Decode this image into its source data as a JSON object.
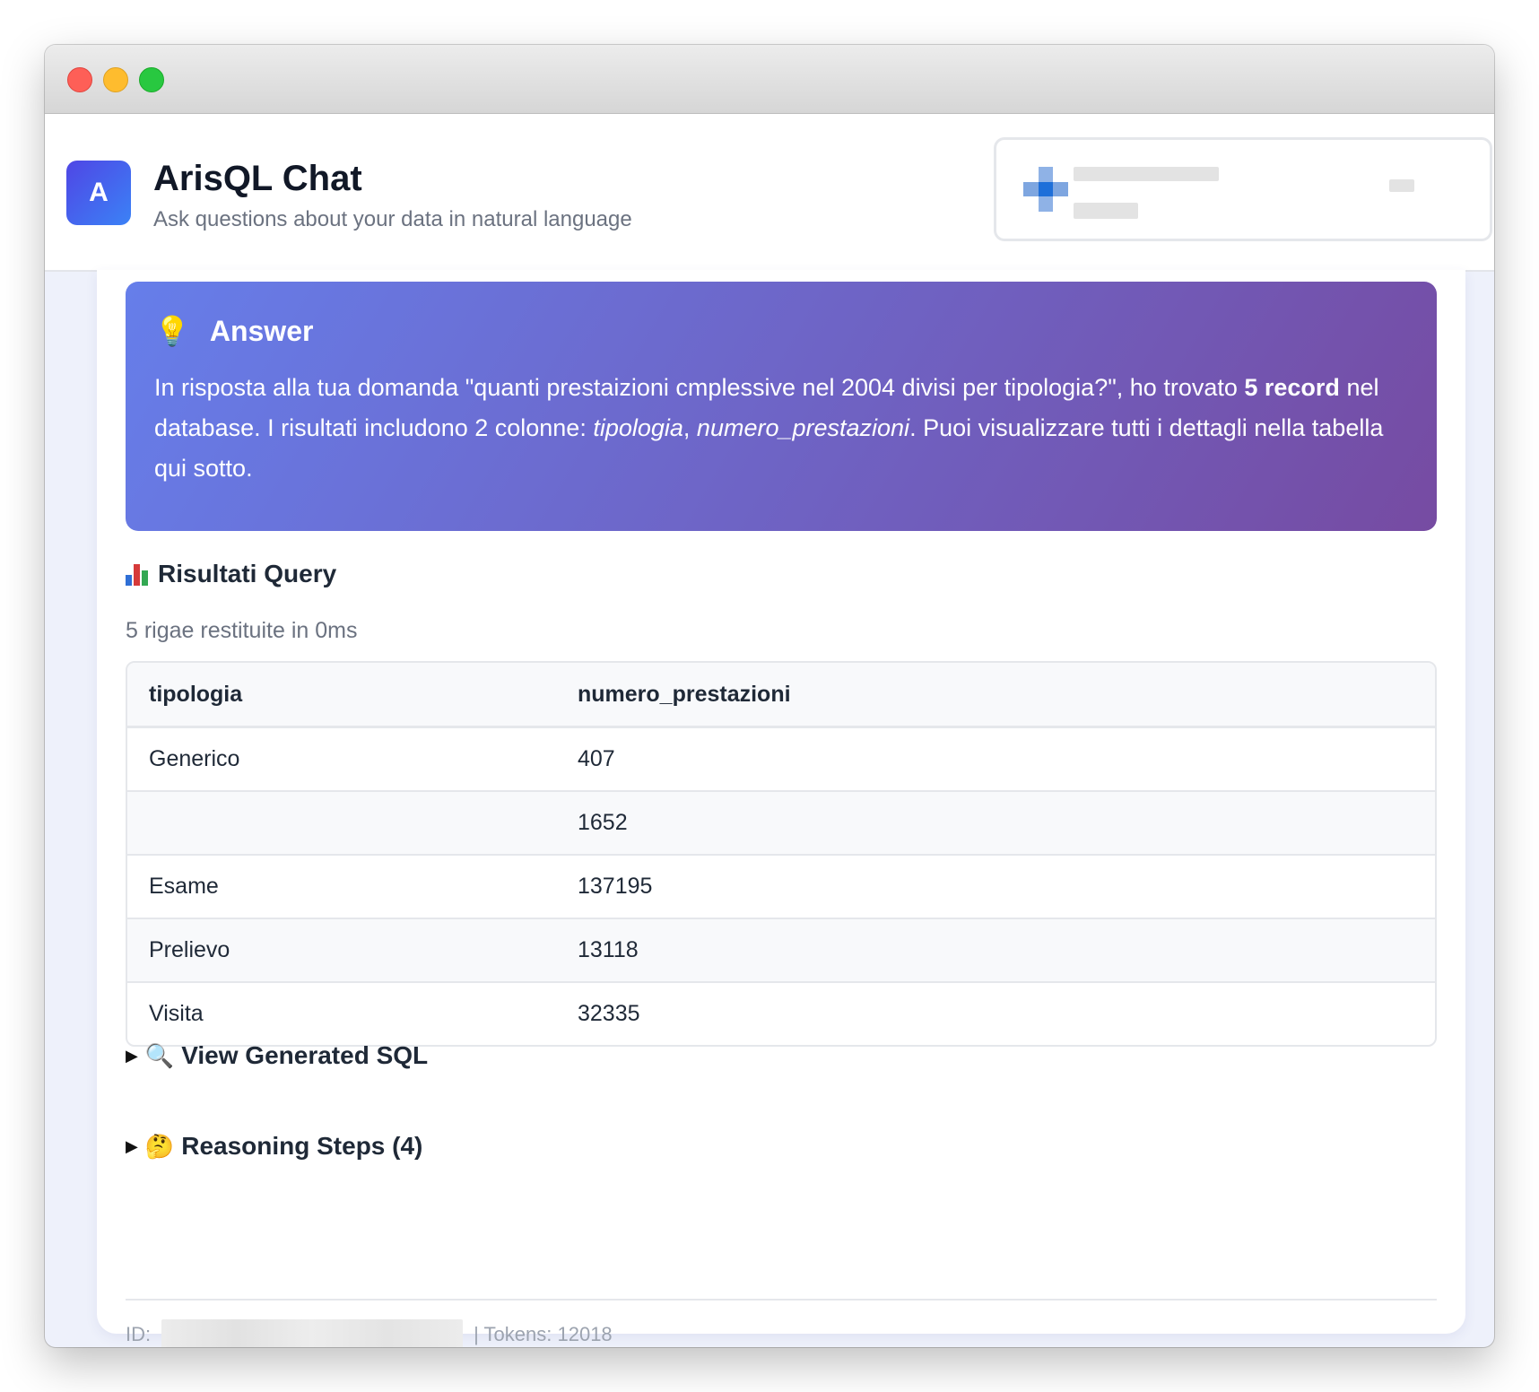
{
  "window": {
    "controls": [
      "close",
      "minimize",
      "zoom"
    ]
  },
  "header": {
    "logo_letter": "A",
    "title": "ArisQL Chat",
    "subtitle": "Ask questions about your data in natural language"
  },
  "answer": {
    "icon": "lightbulb-icon",
    "heading": "Answer",
    "text_prefix": "In risposta alla tua domanda \"quanti prestaizioni cmplessive nel 2004 divisi per tipologia?\", ho trovato ",
    "record_count": "5 record",
    "text_middle": " nel database. I risultati includono 2 colonne: ",
    "col1": "tipologia",
    "comma": ", ",
    "col2": "numero_prestazioni",
    "text_suffix": ". Puoi visualizzare tutti i dettagli nella tabella qui sotto."
  },
  "results": {
    "icon": "bar-chart-icon",
    "title": "Risultati Query",
    "meta": "5 rigae restituite in 0ms",
    "columns": [
      "tipologia",
      "numero_prestazioni"
    ],
    "rows": [
      [
        "Generico",
        "407"
      ],
      [
        "",
        "1652"
      ],
      [
        "Esame",
        "137195"
      ],
      [
        "Prelievo",
        "13118"
      ],
      [
        "Visita",
        "32335"
      ]
    ]
  },
  "sql_toggle": {
    "icon": "magnifier-icon",
    "label": "View Generated SQL"
  },
  "reasoning_toggle": {
    "icon": "thinking-face-icon",
    "label": "Reasoning Steps (4)"
  },
  "footer": {
    "id_label": "ID:",
    "tokens": "| Tokens: 12018"
  },
  "colors": {
    "accent_gradient_start": "#667eea",
    "accent_gradient_end": "#764ba2",
    "logo_start": "#4f46e5",
    "logo_end": "#3b82f6"
  }
}
